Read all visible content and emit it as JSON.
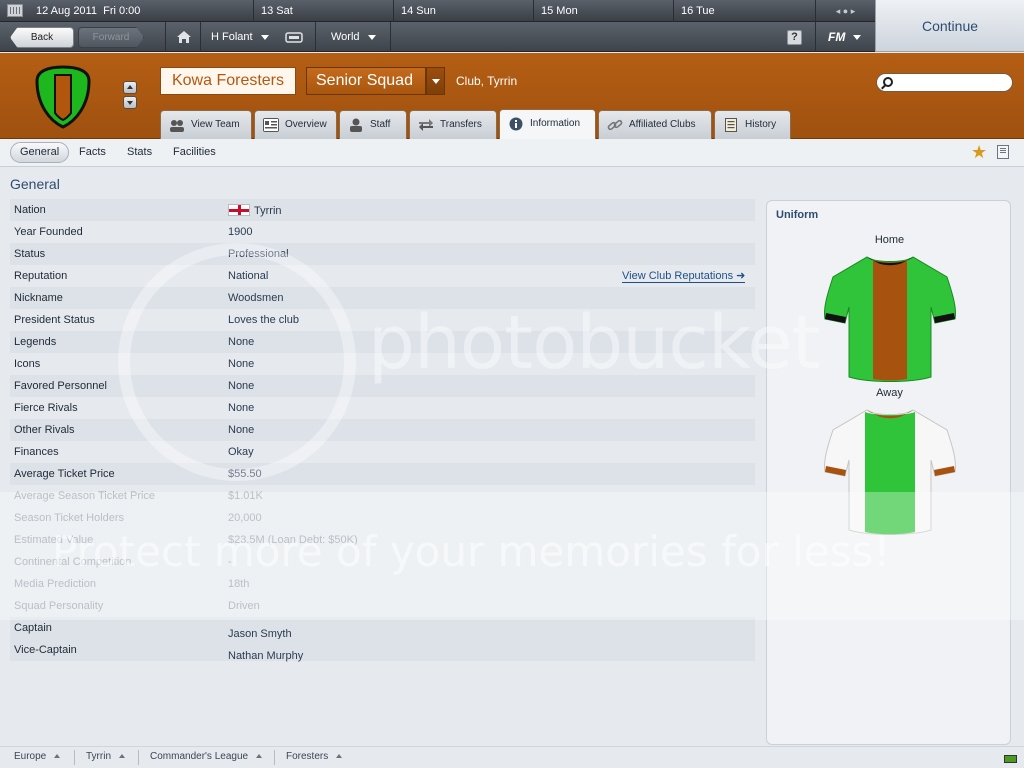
{
  "datebar": {
    "current": "12 Aug 2011",
    "current_day": "Fri 0:00",
    "days": [
      "13 Sat",
      "14 Sun",
      "15 Mon",
      "16 Tue"
    ],
    "dots": "◂ ● ▸"
  },
  "navbar": {
    "back": "Back",
    "forward": "Forward",
    "manager": "H Folant",
    "world": "World",
    "help": "?",
    "fm": "FM"
  },
  "continue": "Continue",
  "club": {
    "name": "Kowa Foresters",
    "squad": "Senior Squad",
    "subtitle": "Club, Tyrrin",
    "crest_colors": {
      "outer": "#1db81d",
      "inner": "#b2560e",
      "border": "#111111"
    }
  },
  "tabs": [
    {
      "label": "View Team",
      "icon": "team-icon"
    },
    {
      "label": "Overview",
      "icon": "overview-icon"
    },
    {
      "label": "Staff",
      "icon": "staff-icon"
    },
    {
      "label": "Transfers",
      "icon": "transfers-icon"
    },
    {
      "label": "Information",
      "icon": "info-icon"
    },
    {
      "label": "Affiliated Clubs",
      "icon": "link-icon"
    },
    {
      "label": "History",
      "icon": "history-icon"
    }
  ],
  "subnav": [
    "General",
    "Facts",
    "Stats",
    "Facilities"
  ],
  "section_title": "General",
  "rows": [
    {
      "label": "Nation",
      "value": "Tyrrin"
    },
    {
      "label": "Year Founded",
      "value": "1900"
    },
    {
      "label": "Status",
      "value": "Professional"
    },
    {
      "label": "Reputation",
      "value": "National",
      "link": "View Club Reputations ➜"
    },
    {
      "label": "Nickname",
      "value": "Woodsmen"
    },
    {
      "label": "President Status",
      "value": "Loves the club"
    },
    {
      "label": "Legends",
      "value": "None"
    },
    {
      "label": "Icons",
      "value": "None"
    },
    {
      "label": "Favored Personnel",
      "value": "None"
    },
    {
      "label": "Fierce Rivals",
      "value": "None"
    },
    {
      "label": "Other Rivals",
      "value": "None"
    },
    {
      "label": "Finances",
      "value": "Okay"
    },
    {
      "label": "Average Ticket Price",
      "value": "$55.50"
    },
    {
      "label": "Average Season Ticket Price",
      "value": "$1.01K"
    },
    {
      "label": "Season Ticket Holders",
      "value": "20,000"
    },
    {
      "label": "Estimated Value",
      "value": "$23.5M (Loan Debt: $50K)"
    },
    {
      "label": "Continental Competition",
      "value": "-"
    },
    {
      "label": "Media Prediction",
      "value": "18th"
    },
    {
      "label": "Squad Personality",
      "value": "Driven"
    },
    {
      "label": "Captain",
      "value": "Jason Smyth"
    },
    {
      "label": "Vice-Captain",
      "value": "Nathan Murphy"
    }
  ],
  "uniform": {
    "title": "Uniform",
    "home": "Home",
    "away": "Away",
    "home_colors": {
      "body": "#2fc43a",
      "stripe": "#a8520f",
      "collar": "#111111"
    },
    "away_colors": {
      "body": "#f7f7f7",
      "stripe": "#2fc43a",
      "trim": "#a8520f"
    }
  },
  "footer": [
    "Europe",
    "Tyrrin",
    "Commander's League",
    "Foresters"
  ],
  "watermark": {
    "logo": "photobucket",
    "tagline": "Protect more of your memories for less!"
  }
}
